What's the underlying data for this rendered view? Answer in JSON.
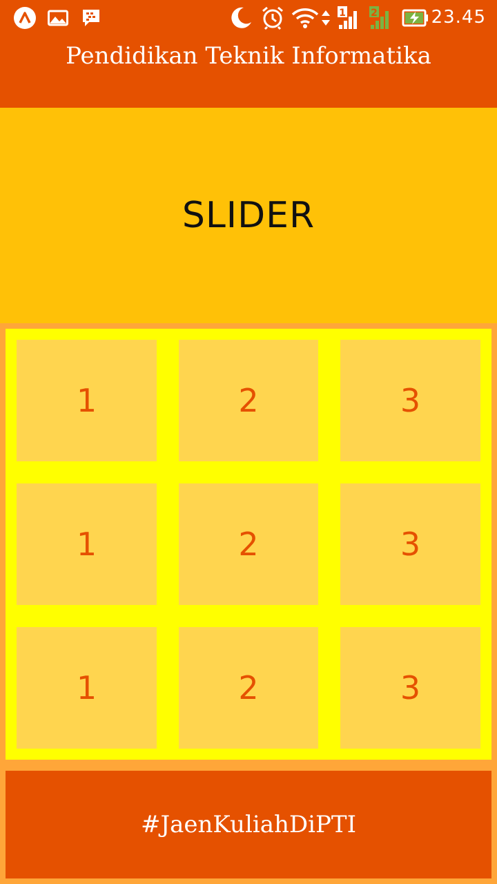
{
  "status_bar": {
    "time": "23.45",
    "icons": [
      "app-a-icon",
      "gallery-icon",
      "bbm-icon",
      "moon-icon",
      "alarm-icon",
      "wifi-icon",
      "signal-sim1-icon",
      "signal-sim2-icon",
      "battery-charging-icon"
    ],
    "sim1_label": "1",
    "sim2_label": "2"
  },
  "app_bar": {
    "title": "Pendidikan Teknik Informatika"
  },
  "slider": {
    "label": "SLIDER"
  },
  "grid": {
    "rows": [
      [
        "1",
        "2",
        "3"
      ],
      [
        "1",
        "2",
        "3"
      ],
      [
        "1",
        "2",
        "3"
      ]
    ]
  },
  "footer": {
    "text": "#JaenKuliahDiPTI"
  },
  "colors": {
    "app_bar": "#e55100",
    "slider": "#ffc107",
    "grid_background": "#ffff00",
    "cell": "#ffd54f",
    "cell_text": "#e55100",
    "page_background": "#ffa639"
  }
}
